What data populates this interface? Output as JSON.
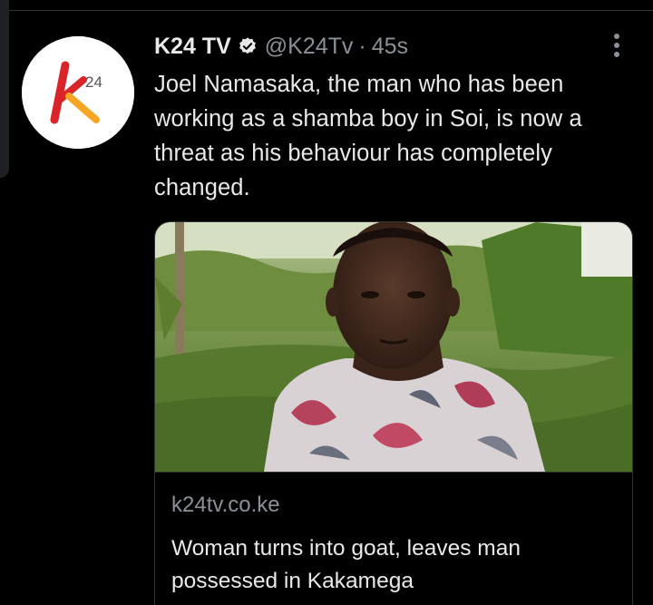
{
  "tweet": {
    "author": {
      "name": "K24 TV",
      "handle": "@K24Tv",
      "verified": true,
      "avatar": {
        "logo_letter": "k",
        "logo_superscript": "24",
        "colors": {
          "red": "#d9252a",
          "orange": "#f5a623",
          "background": "#ffffff"
        }
      }
    },
    "separator": "·",
    "time": "45s",
    "text": "Joel Namasaka, the man who has been working as a shamba boy in Soi, is now a threat as his behaviour has completely changed.",
    "more_icon": "more-vertical-icon",
    "card": {
      "domain": "k24tv.co.ke",
      "title": "Woman turns into goat, leaves man possessed in Kakamega",
      "image_description_icon": "news-photo"
    }
  },
  "theme": {
    "background": "#000000",
    "text_primary": "#e7e9ea",
    "text_secondary": "#8b9196",
    "border": "#2f3336"
  }
}
